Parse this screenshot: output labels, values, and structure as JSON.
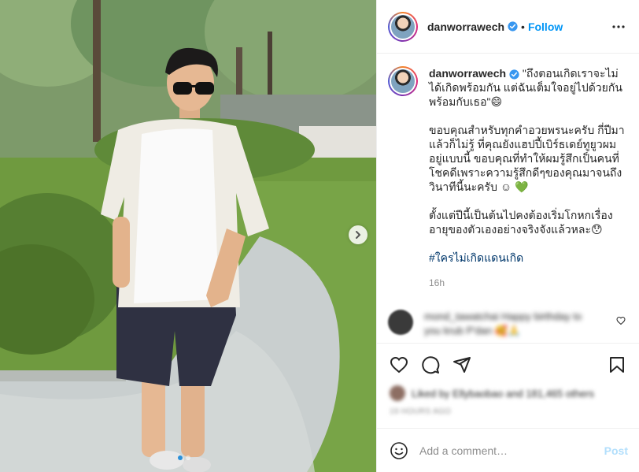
{
  "post": {
    "username": "danworrawech",
    "follow_label": "Follow",
    "separator": "•",
    "caption": {
      "username": "danworrawech",
      "paragraphs": [
        "\"ถึงตอนเกิดเราจะไม่ได้เกิดพร้อมกัน แต่ฉันเต็มใจอยู่ไปด้วยกันพร้อมกับเธอ\"😄",
        "ขอบคุณสำหรับทุกคำอวยพรนะครับ กี่ปีมาแล้วก็ไม่รู้ ที่คุณยังแฮปปี้เบิร์ธเดย์ทูยูวผมอยู่แบบนี้ ขอบคุณที่ทำให้ผมรู้สึกเป็นคนที่โชคดีเพราะความรู้สึกดีๆของคุณมาจนถึงวินาทีนี้นะครับ ☺ 💚",
        "ตั้งแต่ปีนี้เป็นต้นไปคงต้องเริ่มโกหกเรื่องอายุของตัวเองอย่างจริงจังแล้วหละ😯"
      ],
      "hashtag": "#ใครไม่เกิดแดนเกิด",
      "timestamp": "16h"
    },
    "blurred_comment": {
      "text": "mond_tawatchai Happy birthday to you krub P'dan 🥰🙏"
    },
    "likes": {
      "text": "Liked by Ellybaobao and 181,465 others",
      "date": "19 HOURS AGO"
    },
    "add_comment": {
      "placeholder": "Add a comment…",
      "post_label": "Post"
    },
    "colors": {
      "accent": "#0095f6",
      "post_disabled": "#b2dffc",
      "verified": "#3897f0",
      "heart_green": "#3ec43e"
    },
    "icons": [
      "verified-icon",
      "more-icon",
      "heart-icon",
      "comment-icon",
      "share-icon",
      "bookmark-icon",
      "emoji-icon",
      "next-arrow-icon"
    ],
    "carousel": {
      "slide": 1,
      "total": 2
    }
  }
}
